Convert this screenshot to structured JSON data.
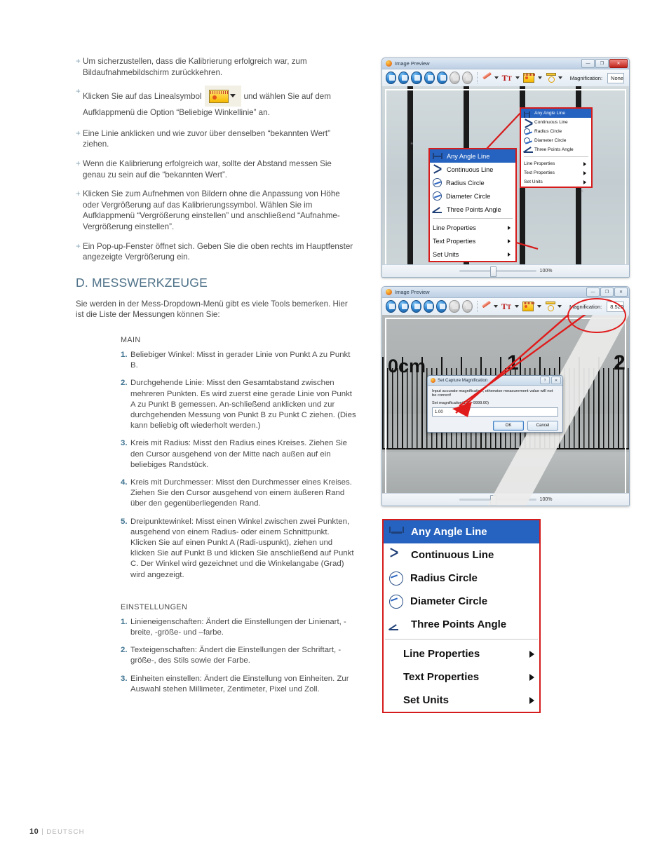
{
  "page": {
    "footer_page": "10",
    "footer_sep": "|",
    "footer_lang": "DEUTSCH"
  },
  "left_column": {
    "bullets": [
      {
        "text": "Um sicherzustellen, dass die Kalibrierung erfolgreich war, zum Bildaufnahmebildschirm zurückkehren."
      },
      {
        "text_before": "Klicken Sie auf das Linealsymbol",
        "has_icon": true,
        "icon_name": "ruler-toolbar-icon",
        "text_after": "und wählen Sie auf dem Aufklappmenü die Option “Beliebige Winkellinie” an."
      },
      {
        "text": "Eine Linie anklicken und wie zuvor über denselben “bekannten Wert” ziehen."
      },
      {
        "text": "Wenn die Kalibrierung erfolgreich war, sollte der Abstand messen Sie genau zu sein auf die “bekannten Wert”."
      },
      {
        "text": "Klicken Sie zum Aufnehmen von Bildern ohne die Anpassung von Höhe oder Vergrößerung auf das Kalibrierungssymbol. Wählen Sie im Aufklappmenü “Vergrößerung einstellen” und anschließend “Aufnahme-Vergrößerung einstellen”."
      },
      {
        "text": "Ein Pop-up-Fenster öffnet sich. Geben Sie die oben rechts im Hauptfenster angezeigte Vergrößerung ein."
      }
    ],
    "heading": "D. MESSWERKZEUGE",
    "intro": "Sie werden in der Mess-Dropdown-Menü gibt es viele Tools bemerken. Hier ist die Liste der Messungen können Sie:",
    "main_title": "MAIN",
    "main_items": [
      {
        "n": "1.",
        "text": "Beliebiger Winkel:  Misst in gerader Linie von Punkt A zu Punkt B."
      },
      {
        "n": "2.",
        "text": "Durchgehende Linie:  Misst den Gesamtabstand zwischen mehreren Punkten. Es wird zuerst eine gerade Linie von Punkt A zu Punkt B gemessen. An-schließend anklicken und zur durchgehenden Messung von Punkt B zu Punkt C ziehen. (Dies kann beliebig oft wiederholt werden.)"
      },
      {
        "n": "3.",
        "text": "Kreis mit Radius:  Misst den Radius eines Kreises. Ziehen Sie den Cursor ausgehend von der Mitte nach außen auf ein beliebiges Randstück."
      },
      {
        "n": "4.",
        "text": "Kreis mit Durchmesser:  Misst den Durchmesser eines Kreises.  Ziehen Sie den Cursor ausgehend von einem äußeren Rand über den gegenüberliegenden Rand."
      },
      {
        "n": "5.",
        "text": "Dreipunktewinkel:  Misst einen Winkel zwischen zwei Punkten, ausgehend von einem Radius- oder einem Schnittpunkt. Klicken Sie auf einen Punkt A (Radi-uspunkt), ziehen und klicken Sie auf Punkt B und klicken Sie anschließend auf Punkt C. Der Winkel wird gezeichnet und die Winkelangabe (Grad) wird angezeigt."
      }
    ],
    "settings_title": "EINSTELLUNGEN",
    "settings_items": [
      {
        "n": "1.",
        "text": "Linieneigenschaften: Ändert die Einstellungen der Linienart, -breite, -größe- und –farbe."
      },
      {
        "n": "2.",
        "text": "Texteigenschaften: Ändert die Einstellungen der Schriftart, -größe-, des Stils sowie der Farbe."
      },
      {
        "n": "3.",
        "text": "Einheiten einstellen: Ändert die Einstellung von Einheiten. Zur Auswahl stehen Millimeter, Zentimeter, Pixel und Zoll."
      }
    ]
  },
  "window_top": {
    "title": "Image Preview",
    "buttons": {
      "minimize": "—",
      "maximize": "❐",
      "close": "✕"
    },
    "toolbar": {
      "magnification_label": "Magnification:",
      "magnification_value": "None"
    },
    "statusbar": {
      "zoom_percent": "100%"
    }
  },
  "window_bottom": {
    "title": "Image Preview",
    "buttons": {
      "minimize": "—",
      "maximize": "❐",
      "close": "✕"
    },
    "toolbar": {
      "magnification_label": "Magnification:",
      "magnification_value": "8.520"
    },
    "statusbar": {
      "zoom_percent": "100%"
    },
    "ruler_labels": [
      "0cm",
      "1",
      "2"
    ],
    "dialog": {
      "title": "Set Capture Magnification",
      "message": "Input accurate magnification, otherwise measurement value will not be correct!",
      "sub_label": "Set magnification(1.00~9999.00)",
      "input_value": "1.00",
      "ok_label": "OK",
      "cancel_label": "Cancel",
      "help_btn": "?",
      "close_btn": "✕"
    }
  },
  "measure_menu": {
    "items": [
      {
        "label": "Any Angle Line",
        "icon": "any-angle-line-icon",
        "selected": true
      },
      {
        "label": "Continuous Line",
        "icon": "continuous-line-icon",
        "selected": false
      },
      {
        "label": "Radius Circle",
        "icon": "radius-circle-icon",
        "selected": false
      },
      {
        "label": "Diameter Circle",
        "icon": "diameter-circle-icon",
        "selected": false
      },
      {
        "label": "Three Points Angle",
        "icon": "three-points-angle-icon",
        "selected": false
      }
    ],
    "submenu_items": [
      {
        "label": "Line Properties",
        "has_arrow": true
      },
      {
        "label": "Text Properties",
        "has_arrow": true
      },
      {
        "label": "Set Units",
        "has_arrow": true
      }
    ]
  },
  "colors": {
    "heading": "#4e7188",
    "number_accent": "#3f7390",
    "callout_red": "#d51b1b",
    "menu_selected": "#2663c0",
    "body_text": "#4b4b4b"
  }
}
